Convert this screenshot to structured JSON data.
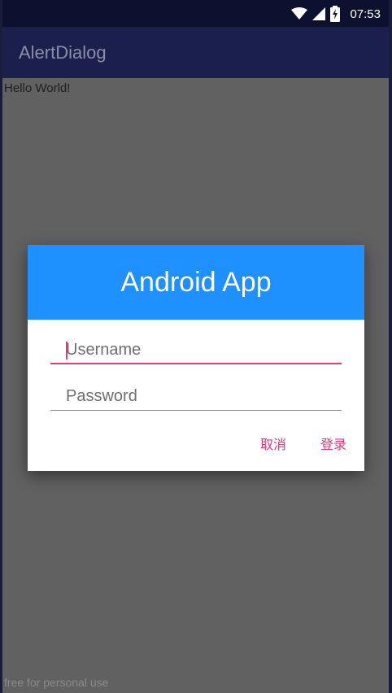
{
  "status_bar": {
    "time": "07:53",
    "icons": [
      "wifi-icon",
      "cell-signal-icon",
      "battery-charging-icon"
    ]
  },
  "app_bar": {
    "title": "AlertDialog"
  },
  "content": {
    "hello_text": "Hello World!",
    "watermark": "free for personal use"
  },
  "dialog": {
    "title": "Android App",
    "username": {
      "placeholder": "Username",
      "value": ""
    },
    "password": {
      "placeholder": "Password",
      "value": ""
    },
    "cancel_label": "取消",
    "login_label": "登录"
  },
  "colors": {
    "dialog_header": "#1e90ff",
    "accent": "#e5397b",
    "status_bar": "#0e1030",
    "app_bar": "#1a1f4d",
    "scrim": "#616161"
  }
}
